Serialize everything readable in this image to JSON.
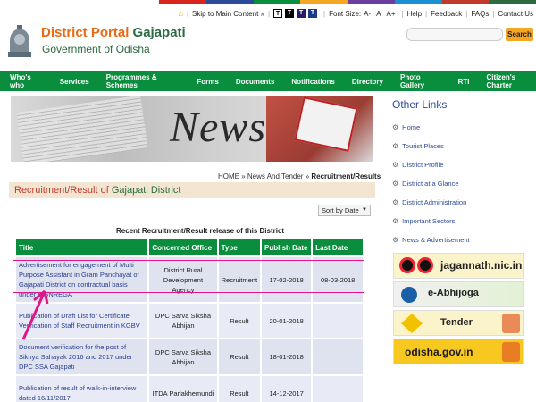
{
  "colors": {
    "nav_green": "#0a8d3d",
    "accent_orange": "#e86b14",
    "title_green": "#2c6b3f",
    "link_blue": "#2c4a9a",
    "highlight_pink": "#e2148a"
  },
  "top_strip_colors": [
    "#d9261c",
    "#2c4a9a",
    "#0a8d3d",
    "#f5a623",
    "#6b3fa0",
    "#1b8fd1",
    "#c0392b",
    "#2c6b3f"
  ],
  "utility": {
    "home_icon": "home-icon",
    "skip": "Skip to Main Content »",
    "contrast": [
      "T",
      "T",
      "T",
      "T"
    ],
    "font_size_label": "Font Size:",
    "font_sizes": [
      "A-",
      "A",
      "A+"
    ],
    "help": "Help",
    "feedback": "Feedback",
    "faqs": "FAQs",
    "contact": "Contact Us"
  },
  "header": {
    "title_prefix": "District Portal",
    "title_name": "Gajapati",
    "subtitle": "Government of Odisha",
    "search_placeholder": "",
    "search_button": "Search"
  },
  "nav": [
    "Who's who",
    "Services",
    "Programmes & Schemes",
    "Forms",
    "Documents",
    "Notifications",
    "Directory",
    "Photo Gallery",
    "RTI",
    "Citizen's Charter"
  ],
  "banner": {
    "text": "News"
  },
  "breadcrumb": {
    "home": "HOME",
    "sep1": " » ",
    "mid": "News And Tender",
    "sep2": " » ",
    "current": "Recruitment/Results"
  },
  "section": {
    "title_prefix": "Recruitment/Result of",
    "title_district": "Gajapati District"
  },
  "sort": {
    "label": "Sort by Date"
  },
  "table": {
    "caption": "Recent Recruitment/Result release of this District",
    "headers": [
      "Title",
      "Concerned Office",
      "Type",
      "Publish Date",
      "Last Date"
    ],
    "rows": [
      {
        "title": "Advertisement for engagement of Multi Purpose Assistant in Gram Panchayat of Gajapati District on contractual basis under MGNREGA",
        "office": "District Rural Development Agency",
        "type": "Recruitment",
        "publish": "17-02-2018",
        "last": "08-03-2018"
      },
      {
        "title": "Publication of Draft List for Certificate Verification of Staff Recruitment in KGBV",
        "office": "DPC Sarva Siksha Abhijan",
        "type": "Result",
        "publish": "20-01-2018",
        "last": ""
      },
      {
        "title": "Document verification for the post of Sikhya Sahayak 2016 and 2017 under DPC SSA Gajapati",
        "office": "DPC Sarva Siksha Abhijan",
        "type": "Result",
        "publish": "18-01-2018",
        "last": ""
      },
      {
        "title": "Publication of result of walk-in-interview dated 16/11/2017",
        "office": "ITDA Parlakhemundi",
        "type": "Result",
        "publish": "14-12-2017",
        "last": ""
      }
    ]
  },
  "other_links": {
    "title": "Other Links",
    "items": [
      "Home",
      "Tourist Places",
      "District Profile",
      "District at a Glance",
      "District Administration",
      "Important Sectors",
      "News & Advertisement"
    ]
  },
  "ads": [
    "jagannath.nic.in",
    "e-Abhijoga",
    "Tender",
    "odisha.gov.in"
  ]
}
